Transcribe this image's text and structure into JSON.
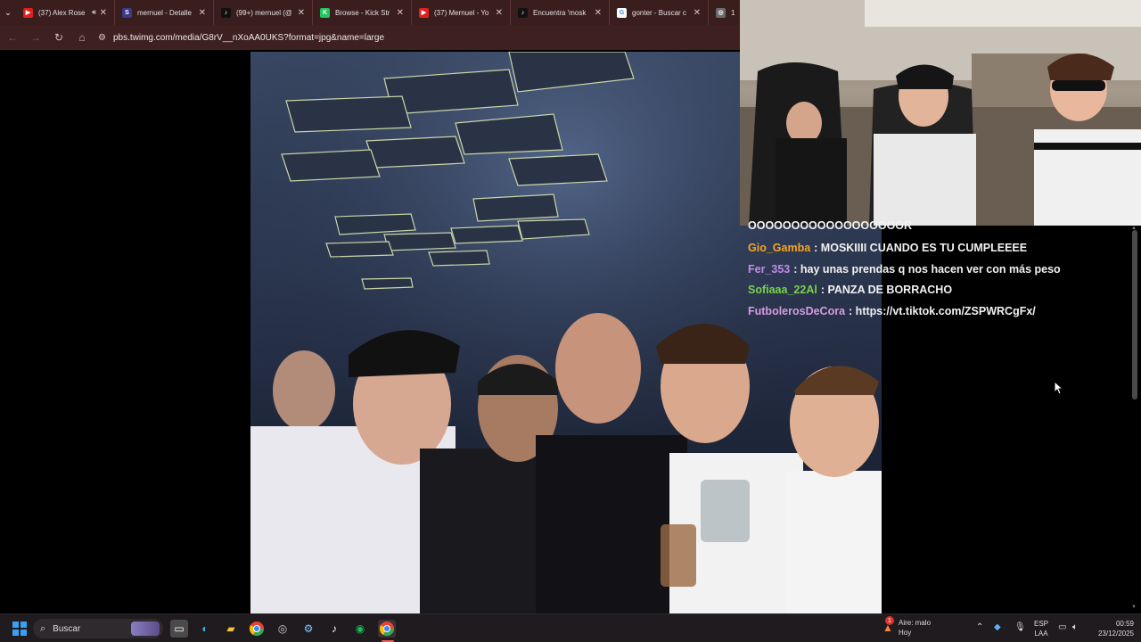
{
  "browser": {
    "tabs": [
      {
        "title": "(37) Alex Rose",
        "fav_color": "#e02020",
        "fav_glyph": "▶",
        "audio": true
      },
      {
        "title": "mernuel - Detalle",
        "fav_color": "#3a3a8a",
        "fav_glyph": "S"
      },
      {
        "title": "(99+) mernuel (@",
        "fav_color": "#111111",
        "fav_glyph": "♪"
      },
      {
        "title": "Browse - Kick Str",
        "fav_color": "#22c55e",
        "fav_glyph": "K"
      },
      {
        "title": "(37) Mernuel - Yo",
        "fav_color": "#e02020",
        "fav_glyph": "▶"
      },
      {
        "title": "Encuentra 'mosk",
        "fav_color": "#111111",
        "fav_glyph": "♪"
      },
      {
        "title": "gonter - Buscar c",
        "fav_color": "#ffffff",
        "fav_glyph": "G"
      },
      {
        "title": "1",
        "fav_color": "#6a6a6a",
        "fav_glyph": "◎"
      }
    ],
    "url": "pbs.twimg.com/media/G8rV__nXoAA0UKS?format=jpg&name=large"
  },
  "chat": {
    "partial_line": "OOOOOOOOOOOOOOOOOOR",
    "messages": [
      {
        "user": "Gio_Gamba",
        "color": "#f5a623",
        "text": ": MOSKIIII CUANDO ES TU CUMPLEEEE"
      },
      {
        "user": "Fer_353",
        "color": "#c38be8",
        "text": ": hay unas prendas q nos hacen ver con más peso"
      },
      {
        "user": "Sofiaaa_22Al",
        "color": "#7bd14b",
        "text": ": PANZA DE BORRACHO"
      },
      {
        "user": "FutbolerosDeCora",
        "color": "#d79be0",
        "text": ": https://vt.tiktok.com/ZSPWRCgFx/"
      }
    ]
  },
  "taskbar": {
    "search_placeholder": "Buscar",
    "weather_title": "Aire: malo",
    "weather_sub": "Hoy",
    "weather_badge": "1",
    "lang_top": "ESP",
    "lang_bottom": "LAA",
    "time": "00:59",
    "date": "23/12/2025"
  }
}
